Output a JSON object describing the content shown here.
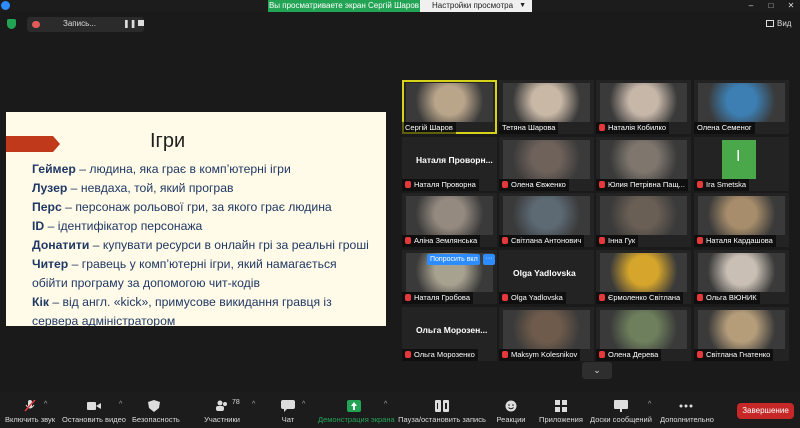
{
  "topbar": {
    "banner": "Вы просматриваете экран Сергій Шаров",
    "view_settings": "Настройки просмотра"
  },
  "meeting": {
    "recording_label": "Запись...",
    "pause_symbol": "❚❚",
    "view_label": "Вид"
  },
  "slide": {
    "title": "Ігри",
    "lines": [
      {
        "term": "Геймер",
        "text": " – людина, яка грає в комп’ютерні ігри"
      },
      {
        "term": "Лузер",
        "text": " – невдаха, той, який програв"
      },
      {
        "term": "Перс",
        "text": " – персонаж рольової гри, за якого грає людина"
      },
      {
        "term": " ID",
        "text": " – ідентифікатор персонажа"
      },
      {
        "term": "Донатити",
        "text": " – купувати ресурси в онлайн грі за реальні гроші"
      },
      {
        "term": "Читер",
        "text": " – гравець у комп’ютерні ігри, який намагається"
      },
      {
        "term": "",
        "text": "обійти програму за допомогою чит-кодів"
      },
      {
        "term": "Кік",
        "text": " – від англ. «kick», примусове викидання гравця із"
      },
      {
        "term": "",
        "text": "сервера адміністратором"
      }
    ]
  },
  "participants": [
    {
      "name": "Сергій Шаров",
      "muted": false,
      "active": true,
      "tone": "#b9a58a"
    },
    {
      "name": "Тетяна Шарова",
      "muted": false,
      "active": false,
      "tone": "#c9b8a6"
    },
    {
      "name": "Наталія Кобилко",
      "muted": true,
      "active": false,
      "tone": "#c7b7a9"
    },
    {
      "name": "Олена Семеног",
      "muted": false,
      "active": false,
      "tone": "#3d7fb3"
    },
    {
      "name": "Наталя Проворна",
      "muted": true,
      "active": false,
      "shown_name": "Наталя Проворн..."
    },
    {
      "name": "Олена Євженко",
      "muted": true,
      "active": false,
      "tone": "#6f625b"
    },
    {
      "name": "Юлия Петрівна Пащ...",
      "muted": true,
      "active": false,
      "tone": "#7f776e"
    },
    {
      "name": "Ira Smetska",
      "muted": true,
      "active": false,
      "tone": "#4aa84a",
      "initial": "I"
    },
    {
      "name": "Аліна Землянська",
      "muted": true,
      "active": false,
      "tone": "#958a80"
    },
    {
      "name": "Світлана Антонович",
      "muted": true,
      "active": false,
      "tone": "#5d6a74"
    },
    {
      "name": "Інна Гук",
      "muted": true,
      "active": false,
      "tone": "#6a5f55"
    },
    {
      "name": "Наталя Кардашова",
      "muted": true,
      "active": false,
      "tone": "#a78d6b"
    },
    {
      "name": "Наталя Гробова",
      "muted": true,
      "active": false,
      "tone": "#a7a18f"
    },
    {
      "name": "Olga Yadlovska",
      "muted": true,
      "active": false,
      "shown_name": "Olga Yadlovska"
    },
    {
      "name": "Єрмоленко Світлана",
      "muted": true,
      "active": false,
      "tone": "#d6a62c"
    },
    {
      "name": "Ольга ВЮНИК",
      "muted": true,
      "active": false,
      "tone": "#c9bfb4"
    },
    {
      "name": "Ольга Морозенко",
      "muted": true,
      "active": false,
      "shown_name": "Ольга Морозен..."
    },
    {
      "name": "Maksym Kolesnikov",
      "muted": true,
      "active": false,
      "tone": "#6f5b4b"
    },
    {
      "name": "Олена Дерева",
      "muted": true,
      "active": false,
      "tone": "#6d7f5c"
    },
    {
      "name": "Світлана Гнатенко",
      "muted": true,
      "active": false,
      "tone": "#b59d7a"
    }
  ],
  "gallery_overlay": {
    "ask_label": "Попросить вкл",
    "more": "···"
  },
  "toolbar": {
    "mute": "Включить звук",
    "video": "Остановить видео",
    "security": "Безопасность",
    "participants": "Участники",
    "participants_count": "78",
    "chat": "Чат",
    "share": "Демонстрация экрана",
    "pause_recording": "Пауза/остановить запись",
    "reactions": "Реакции",
    "apps": "Приложения",
    "whiteboards": "Доски сообщений",
    "more": "Дополнительно",
    "end": "Завершение"
  },
  "colors": {
    "accent_green": "#23a455",
    "end_red": "#c62828",
    "active_outline": "#d6d31a",
    "slide_text": "#1f3864"
  }
}
